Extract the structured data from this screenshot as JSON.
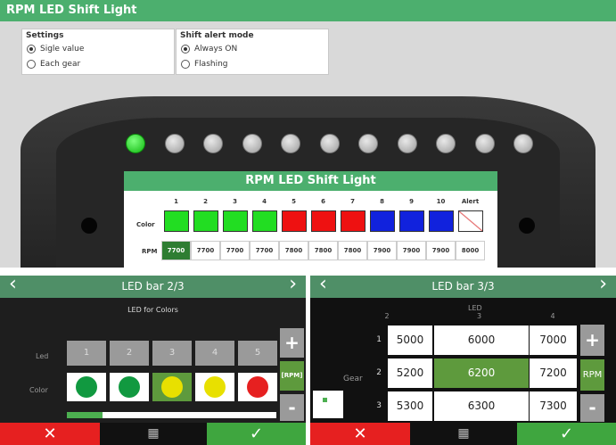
{
  "window": {
    "title": "RPM LED Shift Light"
  },
  "settings": {
    "title": "Settings",
    "options": [
      {
        "label": "Sigle value",
        "selected": true
      },
      {
        "label": "Each gear",
        "selected": false
      }
    ]
  },
  "alert_mode": {
    "title": "Shift alert mode",
    "options": [
      {
        "label": "Always ON",
        "selected": true
      },
      {
        "label": "Flashing",
        "selected": false
      }
    ]
  },
  "device_leds_lit": [
    true,
    false,
    false,
    false,
    false,
    false,
    false,
    false,
    false,
    false,
    false
  ],
  "screen": {
    "title": "RPM LED Shift Light",
    "row_color_label": "Color",
    "row_rpm_label": "RPM",
    "columns": [
      "1",
      "2",
      "3",
      "4",
      "5",
      "6",
      "7",
      "8",
      "9",
      "10",
      "Alert"
    ],
    "colors": [
      "#22dd22",
      "#22dd22",
      "#22dd22",
      "#22dd22",
      "#ee1111",
      "#ee1111",
      "#ee1111",
      "#1122dd",
      "#1122dd",
      "#1122dd",
      "none"
    ],
    "rpm": [
      "7700",
      "7700",
      "7700",
      "7700",
      "7800",
      "7800",
      "7800",
      "7900",
      "7900",
      "7900",
      "8000"
    ]
  },
  "left_pane": {
    "header": "LED bar 2/3",
    "subtitle": "LED for Colors",
    "led_label": "Led",
    "color_label": "Color",
    "leds": [
      "1",
      "2",
      "3",
      "4",
      "5"
    ],
    "colors": [
      "#119940",
      "#119940",
      "#e8e000",
      "#e8e000",
      "#e62020"
    ],
    "selected_index": 2,
    "plus": "+",
    "minus": "-",
    "unit": "[RPM]",
    "progress": 0.17
  },
  "right_pane": {
    "header": "LED bar 3/3",
    "led_label": "LED",
    "gear_label": "Gear",
    "columns": [
      "2",
      "3",
      "4"
    ],
    "rows": [
      {
        "gear": "1",
        "values": [
          "5000",
          "6000",
          "7000"
        ]
      },
      {
        "gear": "2",
        "values": [
          "5200",
          "6200",
          "7200"
        ]
      },
      {
        "gear": "3",
        "values": [
          "5300",
          "6300",
          "7300"
        ]
      }
    ],
    "plus": "+",
    "minus": "-",
    "unit": "RPM"
  },
  "buttons": {
    "cancel": "✕",
    "menu": "▦",
    "ok": "✓"
  }
}
